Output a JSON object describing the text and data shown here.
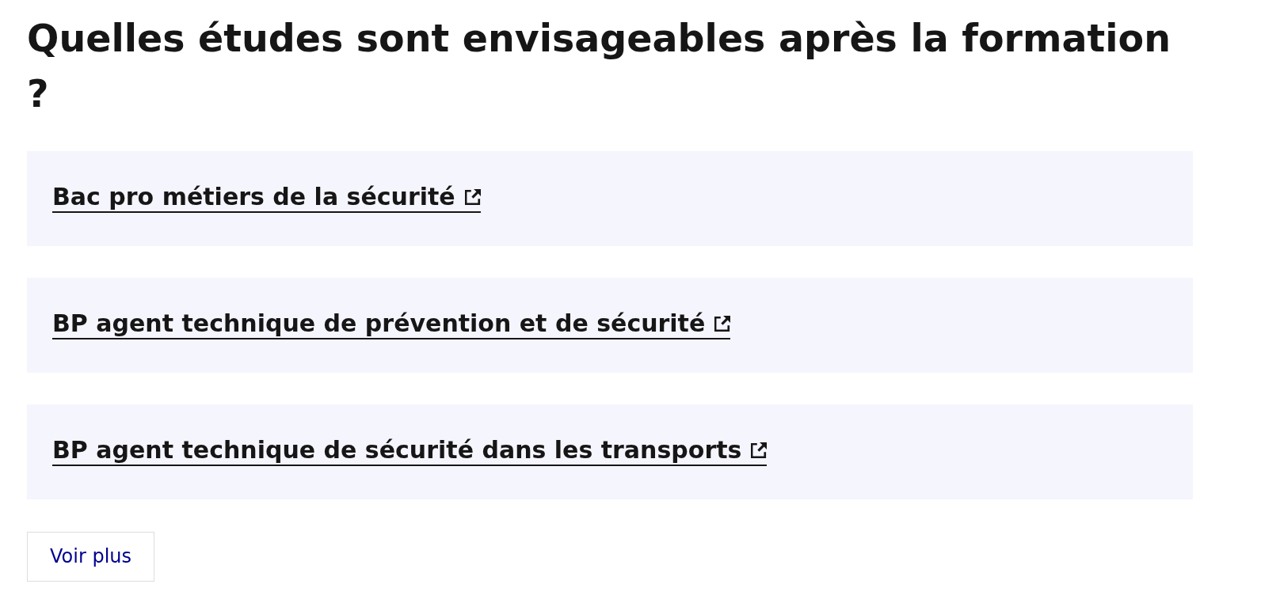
{
  "title": "Quelles études sont envisageables après la formation ?",
  "links": [
    {
      "label": "Bac pro métiers de la sécurité",
      "external": true
    },
    {
      "label": "BP agent technique de prévention et de sécurité",
      "external": true
    },
    {
      "label": "BP agent technique de sécurité dans les transports",
      "external": true
    }
  ],
  "more_button": {
    "label": "Voir plus"
  }
}
